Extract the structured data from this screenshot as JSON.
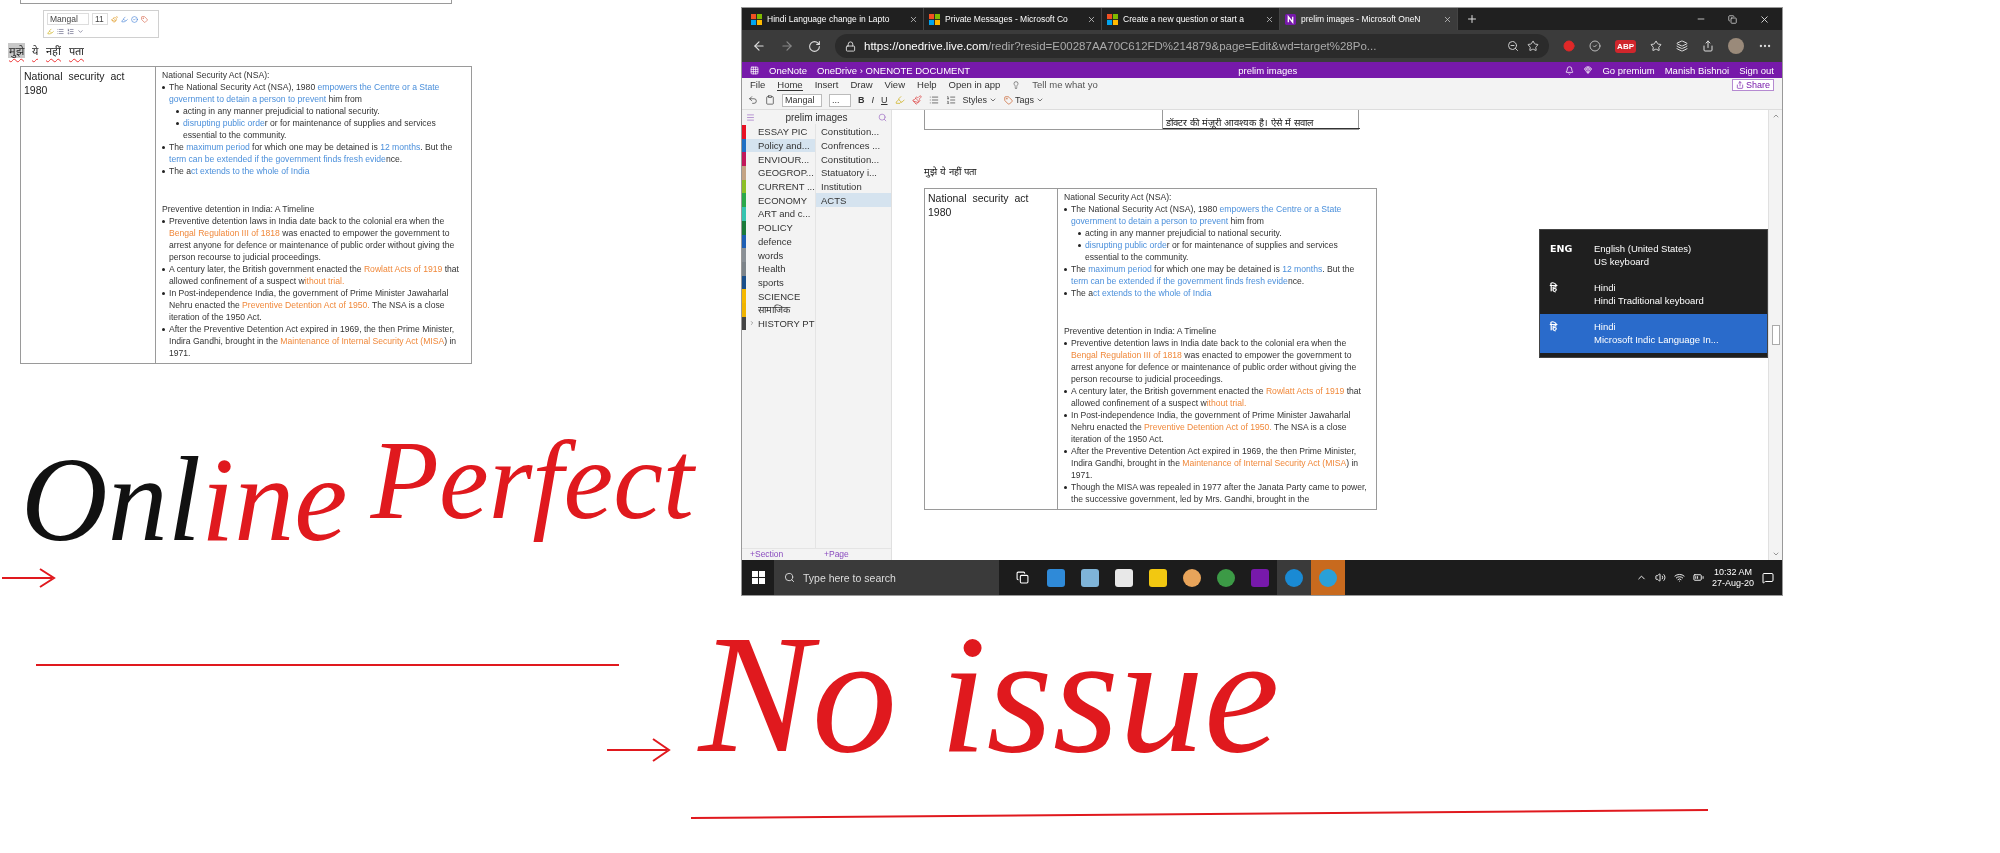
{
  "left_panel": {
    "font_name": "Mangal",
    "font_size": "11",
    "hindi_words": [
      {
        "text": "मुझे",
        "selected": true
      },
      {
        "text": "ये",
        "selected": false
      },
      {
        "text": "नहीं",
        "selected": false
      },
      {
        "text": "पता",
        "selected": false
      }
    ],
    "note_table": {
      "label": "National security act 1980",
      "notes": [
        {
          "kind": "title",
          "segments": [
            {
              "text": "National Security Act (NSA):",
              "kind": "plain"
            }
          ]
        },
        {
          "kind": "bullet",
          "segments": [
            {
              "text": "The National Security Act (NSA), 1980 ",
              "kind": "plain"
            },
            {
              "text": "empowers the Centre or a State government to detain a person to prevent",
              "kind": "link"
            },
            {
              "text": " him from",
              "kind": "plain"
            }
          ],
          "children": [
            {
              "kind": "bullet",
              "segments": [
                {
                  "text": "acting in any manner prejudicial to national security.",
                  "kind": "plain"
                }
              ]
            },
            {
              "kind": "bullet",
              "segments": [
                {
                  "text": "disrupting public orde",
                  "kind": "link"
                },
                {
                  "text": "r or for maintenance of supplies and services essential to the community.",
                  "kind": "plain"
                }
              ]
            }
          ]
        },
        {
          "kind": "bullet",
          "segments": [
            {
              "text": "The ",
              "kind": "plain"
            },
            {
              "text": "maximum period",
              "kind": "link"
            },
            {
              "text": " for which one may be detained is ",
              "kind": "plain"
            },
            {
              "text": "12 months",
              "kind": "link"
            },
            {
              "text": ". But the ",
              "kind": "plain"
            },
            {
              "text": "term can be extended if the government finds fresh evide",
              "kind": "link"
            },
            {
              "text": "nce.",
              "kind": "plain"
            }
          ]
        },
        {
          "kind": "bullet",
          "segments": [
            {
              "text": "The a",
              "kind": "plain"
            },
            {
              "text": "ct extends to the whole of India",
              "kind": "link"
            }
          ]
        },
        {
          "kind": "title",
          "segments": [
            {
              "text": "Preventive detention in India: A Timeline",
              "kind": "plain"
            }
          ]
        },
        {
          "kind": "bullet",
          "segments": [
            {
              "text": "Preventive detention laws in India date back to the colonial era when the ",
              "kind": "plain"
            },
            {
              "text": "Bengal Regulation III of 1818",
              "kind": "highlight"
            },
            {
              "text": " was enacted to empower the government to arrest anyone for defence or maintenance of public order without giving the person recourse to judicial proceedings.",
              "kind": "plain"
            }
          ]
        },
        {
          "kind": "bullet",
          "segments": [
            {
              "text": "A century later, the British government enacted the ",
              "kind": "plain"
            },
            {
              "text": "Rowlatt Acts of 1919",
              "kind": "highlight"
            },
            {
              "text": " that allowed confinement of a suspect w",
              "kind": "plain"
            },
            {
              "text": "ithout trial.",
              "kind": "highlight"
            }
          ]
        },
        {
          "kind": "bullet",
          "segments": [
            {
              "text": "In Post-independence India, the government of Prime Minister Jawaharlal Nehru enacted the ",
              "kind": "plain"
            },
            {
              "text": "Preventive Detention Act of 1950.",
              "kind": "highlight"
            },
            {
              "text": " The NSA is a close iteration of the 1950 Act.",
              "kind": "plain"
            }
          ]
        },
        {
          "kind": "bullet",
          "segments": [
            {
              "text": "After the Preventive Detention Act expired in 1969, the then Prime Minister, Indira Gandhi, brought in the ",
              "kind": "plain"
            },
            {
              "text": "Maintenance of Internal Security Act (MISA",
              "kind": "highlight"
            },
            {
              "text": ") in 1971.",
              "kind": "plain"
            }
          ]
        }
      ]
    }
  },
  "browser": {
    "tabs": [
      {
        "title": "Hindi Language change in Lapto",
        "kind": "microsoft",
        "selected": false
      },
      {
        "title": "Private Messages - Microsoft Co",
        "kind": "microsoft",
        "selected": false
      },
      {
        "title": "Create a new question or start a",
        "kind": "microsoft",
        "selected": false
      },
      {
        "title": "prelim images - Microsoft OneN",
        "kind": "onenote",
        "selected": true
      }
    ],
    "address": {
      "host": "https://onedrive.live.com",
      "path": "/redir?resid=E00287AA70C612FD%214879&page=Edit&wd=target%28Po..."
    },
    "adblock_label": "ABP"
  },
  "onenote": {
    "app_name": "OneNote",
    "breadcrumb": "OneDrive › ONENOTE DOCUMENT",
    "document_title": "prelim images",
    "premium": "Go premium",
    "user": "Manish Bishnoi",
    "sign_out": "Sign out",
    "menu": [
      {
        "label": "File",
        "selected": false
      },
      {
        "label": "Home",
        "selected": true
      },
      {
        "label": "Insert",
        "selected": false
      },
      {
        "label": "Draw",
        "selected": false
      },
      {
        "label": "View",
        "selected": false
      },
      {
        "label": "Help",
        "selected": false
      }
    ],
    "open_in_app": "Open in app",
    "tell_me": "Tell me what yo",
    "share": "Share",
    "toolbar": {
      "font": "Mangal",
      "size": "...",
      "bold": "B",
      "italic": "I",
      "underline": "U",
      "styles": "Styles",
      "tags": "Tags"
    },
    "notebook": {
      "title": "prelim images",
      "sections": [
        {
          "label": "ESSAY PIC",
          "color": "#e81123",
          "kind": "section",
          "selected": false
        },
        {
          "label": "Policy and...",
          "color": "#1e6fc4",
          "kind": "section",
          "selected": true
        },
        {
          "label": "ENVIOUR...",
          "color": "#c2185b",
          "kind": "section",
          "selected": false
        },
        {
          "label": "GEOGROP...",
          "color": "#c4a484",
          "kind": "section",
          "selected": false
        },
        {
          "label": "CURRENT ...",
          "color": "#8cbf26",
          "kind": "section",
          "selected": false
        },
        {
          "label": "ECONOMY",
          "color": "#2aa84a",
          "kind": "section",
          "selected": false
        },
        {
          "label": "ART and c...",
          "color": "#35c4b0",
          "kind": "section",
          "selected": false
        },
        {
          "label": "POLICY",
          "color": "#1a7a3a",
          "kind": "section",
          "selected": false
        },
        {
          "label": "defence",
          "color": "#1e5fb4",
          "kind": "section",
          "selected": false
        },
        {
          "label": "words",
          "color": "#8a9096",
          "kind": "section",
          "selected": false
        },
        {
          "label": "Health",
          "color": "#7d848a",
          "kind": "section",
          "selected": false
        },
        {
          "label": "sports",
          "color": "#1a4f8a",
          "kind": "section",
          "selected": false
        },
        {
          "label": "SCIENCE",
          "color": "#f5b800",
          "kind": "section",
          "selected": false
        },
        {
          "label": "सामाजिक",
          "color": "#f0b400",
          "kind": "section",
          "selected": false
        },
        {
          "label": "HISTORY PT",
          "color": "#444444",
          "kind": "group",
          "selected": false
        }
      ],
      "pages": [
        {
          "label": "Constitution...",
          "selected": false
        },
        {
          "label": "Confrences ...",
          "selected": false
        },
        {
          "label": "Constitution...",
          "selected": false
        },
        {
          "label": "Statuatory i...",
          "selected": false
        },
        {
          "label": "Institution",
          "selected": false
        },
        {
          "label": "ACTS",
          "selected": true
        }
      ],
      "add_section": "+Section",
      "add_page": "+Page"
    },
    "page": {
      "cut_text": "डॉक्टर की मंज़ूरी आवश्यक है। ऐसे में सवाल",
      "note_text": "मुझे ये नहीं पता",
      "note_table": {
        "label": "National security act 1980",
        "notes": [
          {
            "kind": "title",
            "segments": [
              {
                "text": "National Security Act (NSA):",
                "kind": "plain"
              }
            ]
          },
          {
            "kind": "bullet",
            "segments": [
              {
                "text": "The National Security Act (NSA), 1980 ",
                "kind": "plain"
              },
              {
                "text": "empowers the Centre or a State government to detain a person to prevent",
                "kind": "link"
              },
              {
                "text": " him from",
                "kind": "plain"
              }
            ],
            "children": [
              {
                "kind": "bullet",
                "segments": [
                  {
                    "text": "acting in any manner prejudicial to national security.",
                    "kind": "plain"
                  }
                ]
              },
              {
                "kind": "bullet",
                "segments": [
                  {
                    "text": "disrupting public orde",
                    "kind": "link"
                  },
                  {
                    "text": "r or for maintenance of supplies and services essential to the community.",
                    "kind": "plain"
                  }
                ]
              }
            ]
          },
          {
            "kind": "bullet",
            "segments": [
              {
                "text": "The ",
                "kind": "plain"
              },
              {
                "text": "maximum period",
                "kind": "link"
              },
              {
                "text": " for which one may be detained is ",
                "kind": "plain"
              },
              {
                "text": "12 months",
                "kind": "link"
              },
              {
                "text": ". But the ",
                "kind": "plain"
              },
              {
                "text": "term can be extended if the government finds fresh evide",
                "kind": "link"
              },
              {
                "text": "nce.",
                "kind": "plain"
              }
            ]
          },
          {
            "kind": "bullet",
            "segments": [
              {
                "text": "The a",
                "kind": "plain"
              },
              {
                "text": "ct extends to the whole of India",
                "kind": "link"
              }
            ]
          },
          {
            "kind": "title",
            "segments": [
              {
                "text": "Preventive detention in India: A Timeline",
                "kind": "plain"
              }
            ]
          },
          {
            "kind": "bullet",
            "segments": [
              {
                "text": "Preventive detention laws in India date back to the colonial era when the ",
                "kind": "plain"
              },
              {
                "text": "Bengal Regulation III of 1818",
                "kind": "highlight"
              },
              {
                "text": " was enacted to empower the government to arrest anyone for defence or maintenance of public order without giving the person recourse to judicial proceedings.",
                "kind": "plain"
              }
            ]
          },
          {
            "kind": "bullet",
            "segments": [
              {
                "text": "A century later, the British government enacted the ",
                "kind": "plain"
              },
              {
                "text": "Rowlatt Acts of 1919",
                "kind": "highlight"
              },
              {
                "text": " that allowed confinement of a suspect w",
                "kind": "plain"
              },
              {
                "text": "ithout trial.",
                "kind": "highlight"
              }
            ]
          },
          {
            "kind": "bullet",
            "segments": [
              {
                "text": "In Post-independence India, the government of Prime Minister Jawaharlal Nehru enacted the ",
                "kind": "plain"
              },
              {
                "text": "Preventive Detention Act of 1950.",
                "kind": "highlight"
              },
              {
                "text": " The NSA is a close iteration of the 1950 Act.",
                "kind": "plain"
              }
            ]
          },
          {
            "kind": "bullet",
            "segments": [
              {
                "text": "After the Preventive Detention Act expired in 1969, the then Prime Minister, Indira Gandhi, brought in the ",
                "kind": "plain"
              },
              {
                "text": "Maintenance of Internal Security Act (MISA",
                "kind": "highlight"
              },
              {
                "text": ") in 1971.",
                "kind": "plain"
              }
            ]
          },
          {
            "kind": "bullet",
            "segments": [
              {
                "text": "Though the MISA was repealed in 1977 after the Janata Party came to power, the successive government, led by Mrs. Gandhi, brought in the",
                "kind": "plain"
              }
            ]
          }
        ]
      }
    }
  },
  "language_menu": [
    {
      "code": "ENG",
      "name": "English (United States)",
      "keyboard": "US keyboard",
      "selected": false
    },
    {
      "code": "हि",
      "name": "Hindi",
      "keyboard": "Hindi Traditional keyboard",
      "selected": false
    },
    {
      "code": "हि",
      "name": "Hindi",
      "keyboard": "Microsoft Indic Language In...",
      "selected": true
    }
  ],
  "taskbar": {
    "search_placeholder": "Type here to search",
    "time": "10:32 AM",
    "date": "27-Aug-20"
  },
  "annotations": [
    {
      "segments": [
        {
          "text": "Onl",
          "color": "#111111"
        },
        {
          "text": "ine",
          "color": "#e0191e"
        }
      ]
    },
    {
      "segments": [
        {
          "text": "Perfect",
          "color": "#e0191e"
        }
      ]
    },
    {
      "segments": [
        {
          "text": "No issue",
          "color": "#e0191e"
        }
      ]
    }
  ]
}
